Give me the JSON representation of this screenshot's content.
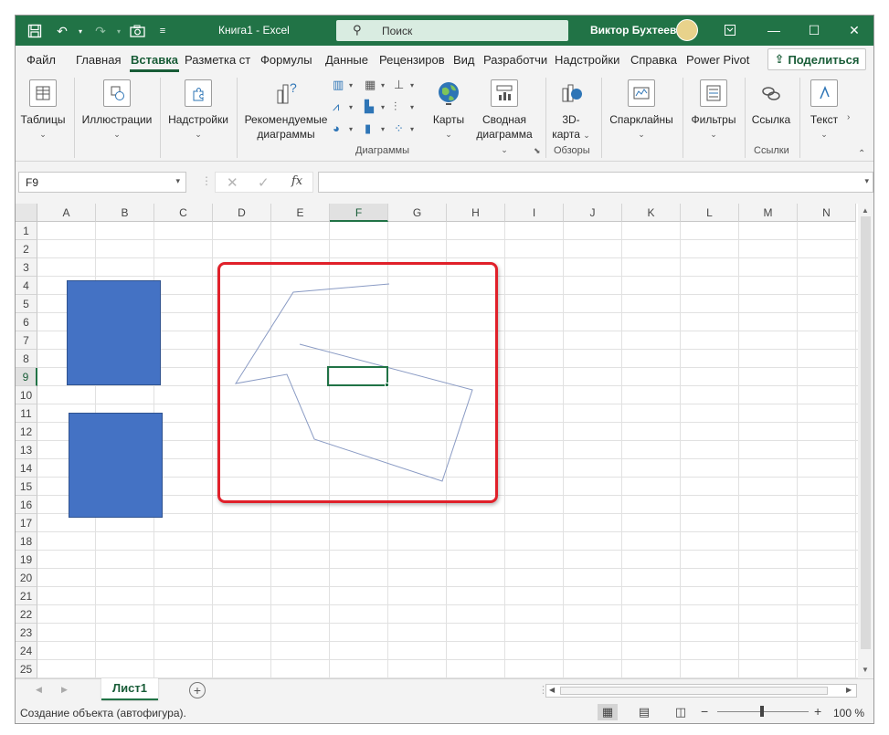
{
  "window": {
    "title": "Книга1 - Excel",
    "search_placeholder": "Поиск",
    "user": "Виктор Бухтеев"
  },
  "menu": {
    "tabs": [
      {
        "label": "Файл"
      },
      {
        "label": "Главная"
      },
      {
        "label": "Вставка"
      },
      {
        "label": "Разметка ст"
      },
      {
        "label": "Формулы"
      },
      {
        "label": "Данные"
      },
      {
        "label": "Рецензиров"
      },
      {
        "label": "Вид"
      },
      {
        "label": "Разработчи"
      },
      {
        "label": "Надстройки"
      },
      {
        "label": "Справка"
      },
      {
        "label": "Power Pivot"
      }
    ],
    "active_tab": "Вставка",
    "share_label": "Поделиться"
  },
  "ribbon": {
    "tables": "Таблицы",
    "illustrations": "Иллюстрации",
    "addins": "Надстройки",
    "recommended_charts_line1": "Рекомендуемые",
    "recommended_charts_line2": "диаграммы",
    "maps": "Карты",
    "pivot_chart_line1": "Сводная",
    "pivot_chart_line2": "диаграмма",
    "map3d_line1": "3D-",
    "map3d_line2": "карта",
    "sparklines": "Спарклайны",
    "filters": "Фильтры",
    "link": "Ссылка",
    "text": "Текст",
    "group_charts": "Диаграммы",
    "group_tours": "Обзоры",
    "group_links": "Ссылки"
  },
  "formula_bar": {
    "name_box": "F9",
    "cancel": "✕",
    "enter": "✓",
    "fx": "fx",
    "value": ""
  },
  "grid": {
    "columns": [
      "A",
      "B",
      "C",
      "D",
      "E",
      "F",
      "G",
      "H",
      "I",
      "J",
      "K",
      "L",
      "M",
      "N"
    ],
    "rows": [
      "1",
      "2",
      "3",
      "4",
      "5",
      "6",
      "7",
      "8",
      "9",
      "10",
      "11",
      "12",
      "13",
      "14",
      "15",
      "16",
      "17",
      "18",
      "19",
      "20",
      "21",
      "22",
      "23",
      "24",
      "25"
    ],
    "selected_column": "F",
    "selected_row": "9",
    "shape_color": "#4472c4",
    "highlight_color": "#e0202a"
  },
  "sheets": {
    "tabs": [
      {
        "label": "Лист1"
      }
    ],
    "add_label": "+"
  },
  "status": {
    "text": "Создание объекта (автофигура).",
    "zoom": "100 %"
  },
  "colors": {
    "brand": "#217346",
    "dark_green": "#185c37"
  }
}
